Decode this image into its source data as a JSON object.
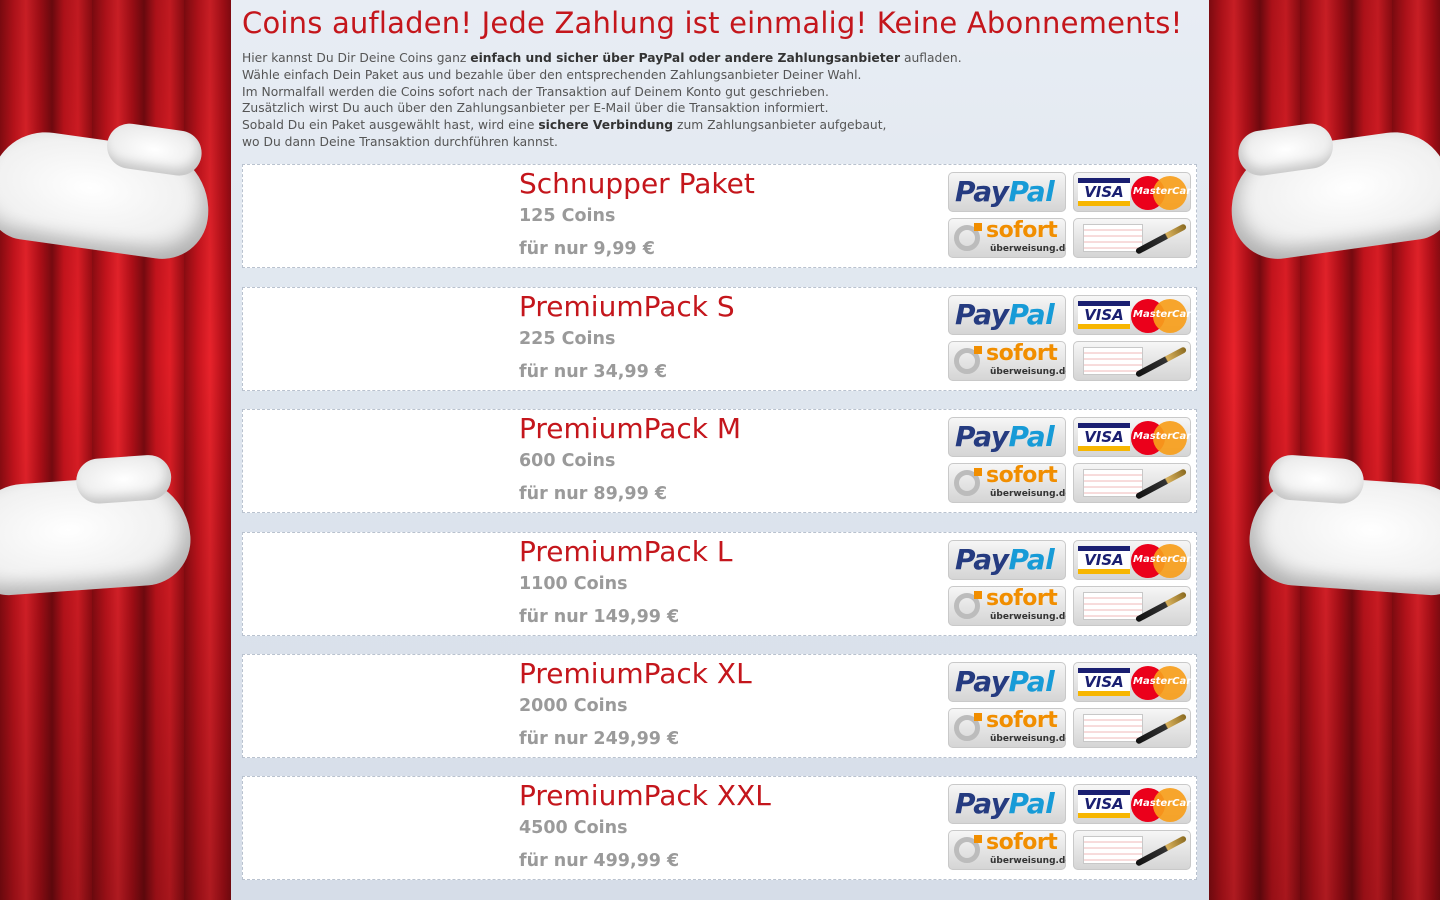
{
  "headline": "Coins aufladen! Jede Zahlung ist einmalig! Keine Abonnements!",
  "intro": {
    "l1_a": "Hier kannst Du Dir Deine Coins ganz ",
    "l1_b": "einfach und sicher über PayPal oder andere Zahlungsanbieter",
    "l1_c": " aufladen.",
    "l2": "Wähle einfach Dein Paket aus und bezahle über den entsprechenden Zahlungsanbieter Deiner Wahl.",
    "l3": "Im Normalfall werden die Coins sofort nach der Transaktion auf Deinem Konto gut geschrieben.",
    "l4": "Zusätzlich wirst Du auch über den Zahlungsanbieter per E-Mail über die Transaktion informiert.",
    "l5_a": "Sobald Du ein Paket ausgewählt hast, wird eine ",
    "l5_b": "sichere Verbindung",
    "l5_c": " zum Zahlungsanbieter aufgebaut,",
    "l6": "wo Du dann Deine Transaktion durchführen kannst."
  },
  "payment_labels": {
    "paypal_a": "Pay",
    "paypal_b": "Pal",
    "visa": "VISA",
    "mastercard": "MasterCard",
    "sofort": "sofort",
    "sofort_sub": "überweisung.de"
  },
  "packages": [
    {
      "name": "Schnupper Paket",
      "coins": "125 Coins",
      "price": "für nur 9,99 €"
    },
    {
      "name": "PremiumPack S",
      "coins": "225 Coins",
      "price": "für nur 34,99 €"
    },
    {
      "name": "PremiumPack M",
      "coins": "600 Coins",
      "price": "für nur 89,99 €"
    },
    {
      "name": "PremiumPack L",
      "coins": "1100 Coins",
      "price": "für nur 149,99 €"
    },
    {
      "name": "PremiumPack XL",
      "coins": "2000 Coins",
      "price": "für nur 249,99 €"
    },
    {
      "name": "PremiumPack XXL",
      "coins": "4500 Coins",
      "price": "für nur 499,99 €"
    }
  ],
  "colors": {
    "headline": "#c4161c",
    "package_name": "#c4161c",
    "package_detail": "#9a9a9a",
    "curtain": "#d41920",
    "stage": "#2553c3"
  }
}
